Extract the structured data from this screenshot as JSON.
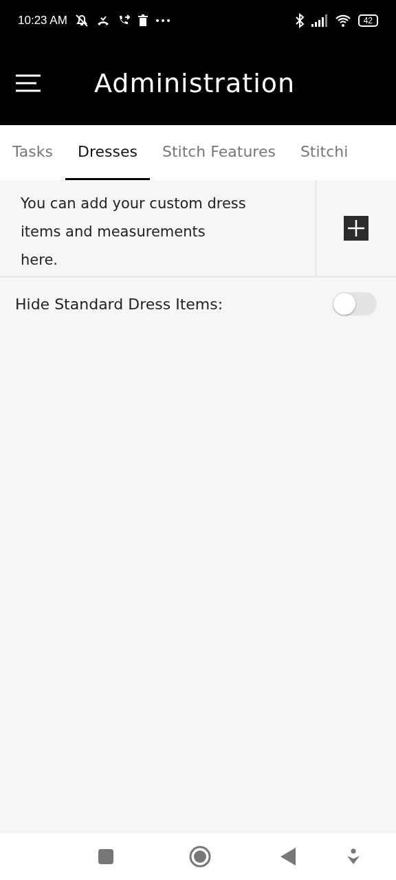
{
  "status_bar": {
    "time": "10:23 AM",
    "battery": "42"
  },
  "app_bar": {
    "title": "Administration"
  },
  "tabs": [
    {
      "label": "Tasks",
      "selected": false
    },
    {
      "label": "Dresses",
      "selected": true
    },
    {
      "label": "Stitch Features",
      "selected": false
    },
    {
      "label": "Stitchi",
      "selected": false
    }
  ],
  "info": {
    "text": "You can add your custom dress items and measurements here."
  },
  "settings": [
    {
      "label": "Hide Standard Dress Items:",
      "on": false
    }
  ]
}
